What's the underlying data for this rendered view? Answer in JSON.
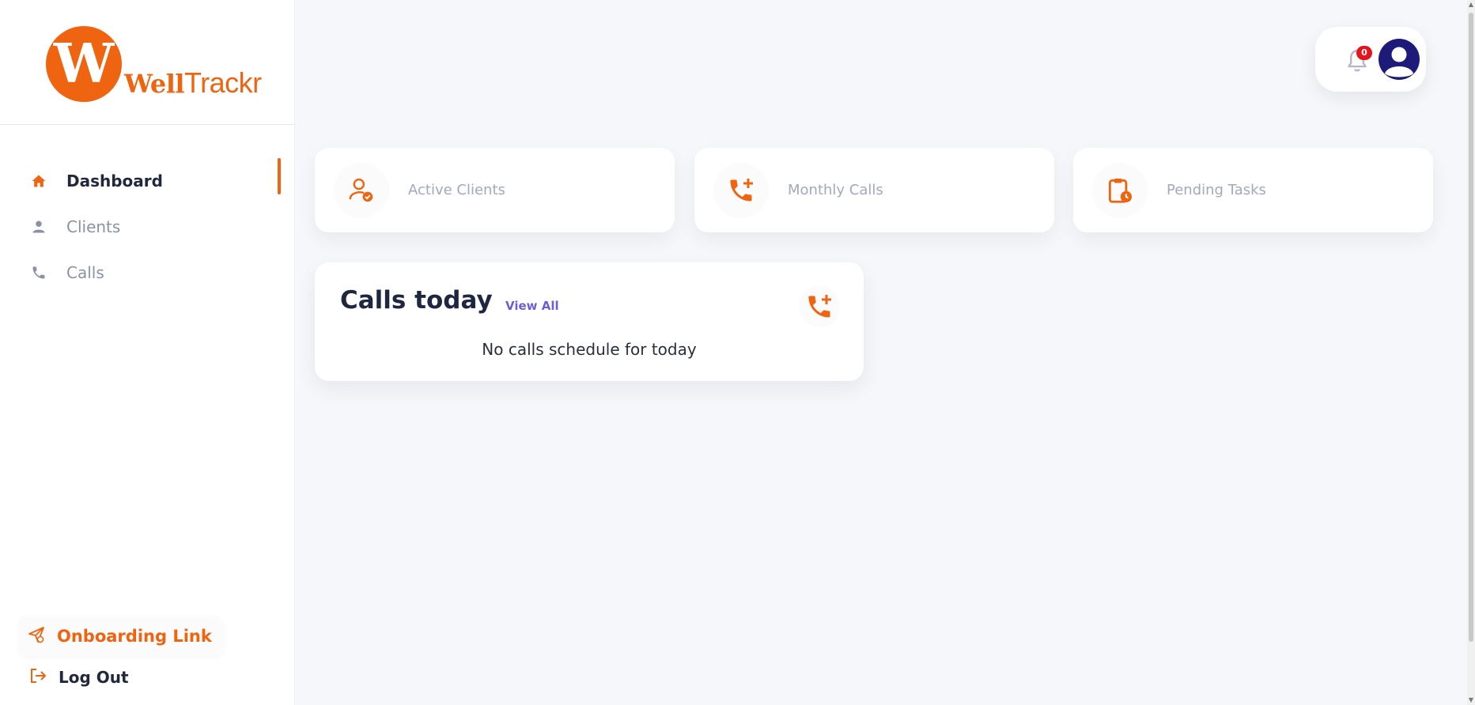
{
  "app": {
    "brand_initial": "W",
    "brand_name_bold": "Well",
    "brand_name_rest": "Trackr",
    "accent_color": "#ef6410"
  },
  "sidebar": {
    "items": [
      {
        "label": "Dashboard",
        "icon": "home-icon",
        "active": true
      },
      {
        "label": "Clients",
        "icon": "person-icon",
        "active": false
      },
      {
        "label": "Calls",
        "icon": "phone-icon",
        "active": false
      }
    ],
    "onboarding_label": "Onboarding Link",
    "logout_label": "Log Out"
  },
  "header": {
    "notification_count": "0"
  },
  "stats": [
    {
      "label": "Active Clients",
      "icon": "client-check-icon"
    },
    {
      "label": "Monthly Calls",
      "icon": "phone-plus-icon"
    },
    {
      "label": "Pending Tasks",
      "icon": "clipboard-clock-icon"
    }
  ],
  "calls_today": {
    "title": "Calls today",
    "view_all": "View All",
    "empty_message": "No calls schedule for today"
  }
}
